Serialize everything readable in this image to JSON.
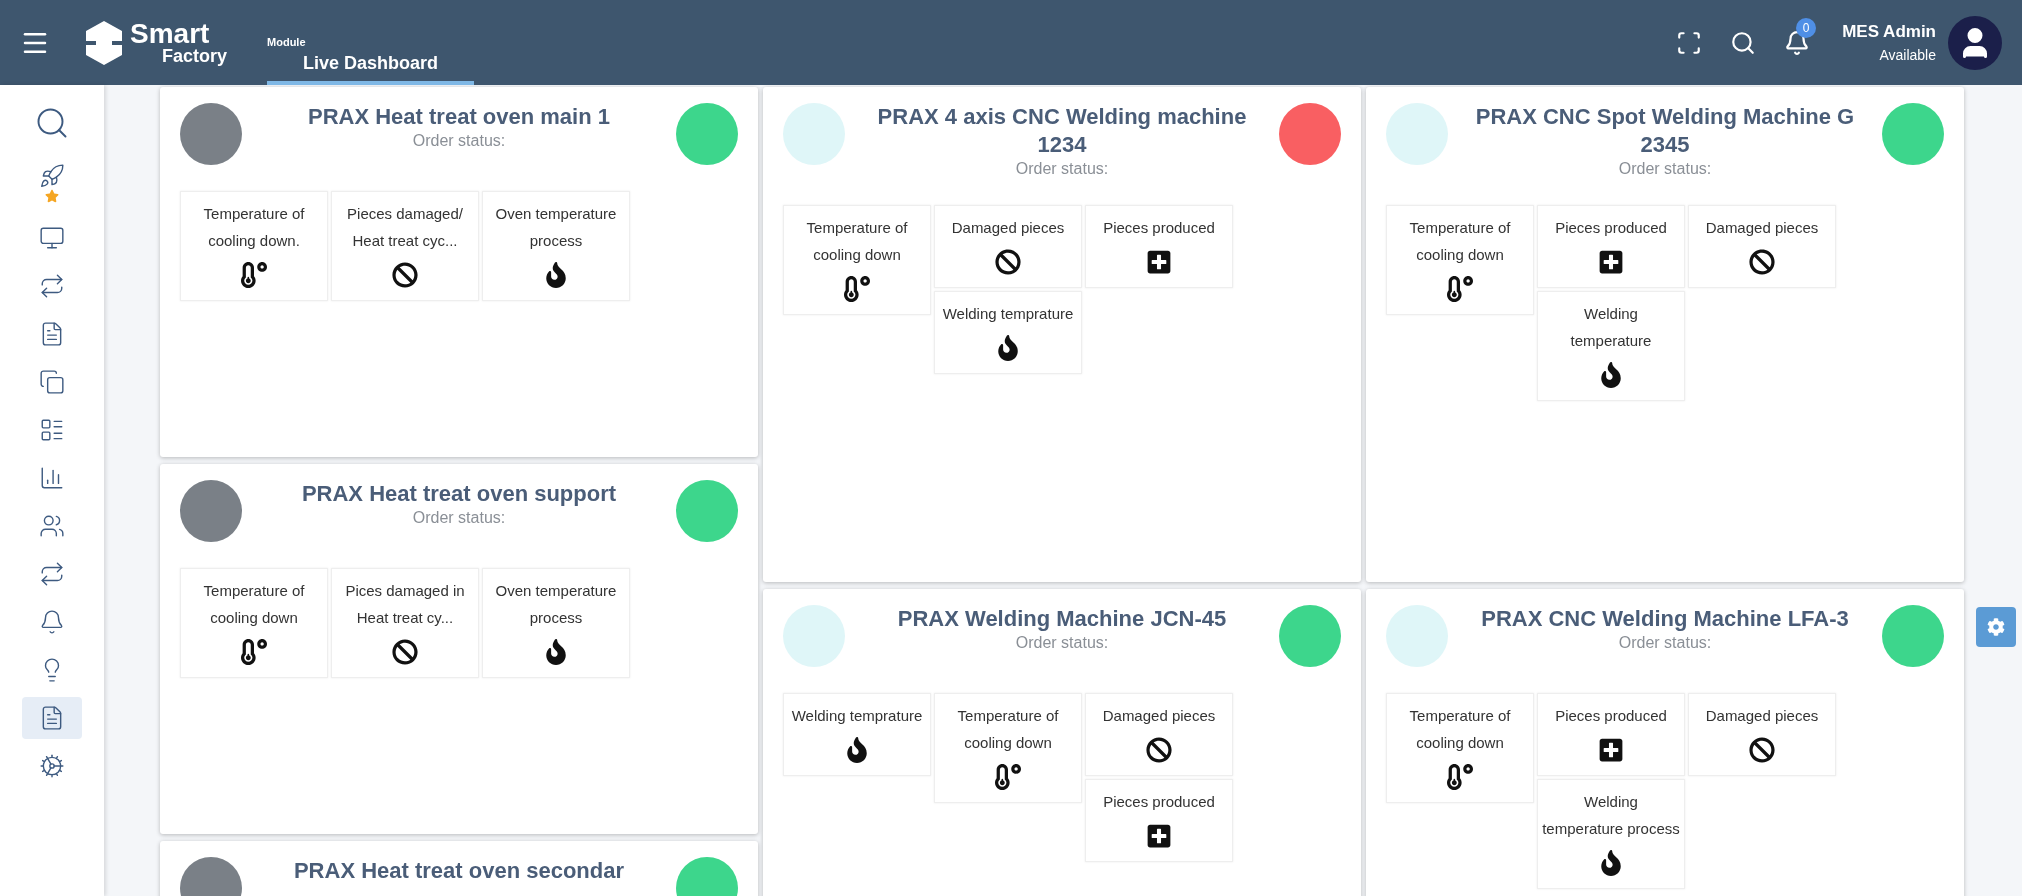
{
  "header": {
    "logo": {
      "line1": "Smart",
      "line2": "Factory"
    },
    "module_label": "Module",
    "tab": {
      "label": "Live Dashboard",
      "selected": true
    },
    "notifications": "0",
    "user": {
      "name": "MES Admin",
      "status": "Available"
    }
  },
  "sidebar": [
    {
      "kind": "search",
      "selected": false
    },
    {
      "kind": "rocket",
      "selected": false
    },
    {
      "kind": "monitor",
      "selected": false
    },
    {
      "kind": "repeat",
      "selected": false
    },
    {
      "kind": "document",
      "selected": false
    },
    {
      "kind": "copy",
      "selected": false
    },
    {
      "kind": "list",
      "selected": false
    },
    {
      "kind": "chart",
      "selected": false
    },
    {
      "kind": "users",
      "selected": false
    },
    {
      "kind": "repeat",
      "selected": false
    },
    {
      "kind": "bell",
      "selected": false
    },
    {
      "kind": "bulb",
      "selected": false
    },
    {
      "kind": "document",
      "selected": true
    },
    {
      "kind": "cogs",
      "selected": false
    }
  ],
  "columns": [
    [
      {
        "title_lines": [
          "PRAX Heat treat oven main 1"
        ],
        "subtitle": "Order status:",
        "color": "#3dd68c",
        "tiles": [
          [
            {
              "label": "Temperature of cooling down.",
              "kind": "thermometer"
            }
          ],
          [
            {
              "label": "Pieces damaged/ Heat treat cyc...",
              "kind": "ban"
            }
          ],
          [
            {
              "label": "Oven temperature process",
              "kind": "fire"
            }
          ]
        ]
      },
      {
        "title_lines": [
          "PRAX Heat treat oven support"
        ],
        "subtitle": "Order status:",
        "color": "#3dd68c",
        "tiles": [
          [
            {
              "label": "Temperature of cooling down",
              "kind": "thermometer"
            }
          ],
          [
            {
              "label": "Pices damaged in Heat treat cy...",
              "kind": "ban"
            }
          ],
          [
            {
              "label": "Oven temperature process",
              "kind": "fire"
            }
          ]
        ]
      },
      {
        "title_lines": [
          "PRAX Heat treat oven secondar"
        ],
        "color": "#3dd68c"
      }
    ],
    [
      {
        "title_lines": [
          "PRAX 4 axis CNC Welding machine",
          "1234"
        ],
        "subtitle": "Order status:",
        "color": "#f95f62",
        "tiles": [
          [
            {
              "label": "Temperature of cooling down",
              "kind": "thermometer"
            }
          ],
          [
            {
              "label": "Damaged pieces",
              "kind": "ban"
            },
            {
              "label": "Welding temprature",
              "kind": "fire"
            }
          ],
          [
            {
              "label": "Pieces produced",
              "kind": "plus"
            }
          ]
        ]
      },
      {
        "title_lines": [
          "PRAX Welding Machine JCN-45"
        ],
        "subtitle": "Order status:",
        "color": "#3dd68c",
        "tiles": [
          [
            {
              "label": "Welding temprature",
              "kind": "fire"
            }
          ],
          [
            {
              "label": "Temperature of cooling down",
              "kind": "thermometer"
            }
          ],
          [
            {
              "label": "Damaged pieces",
              "kind": "ban"
            },
            {
              "label": "Pieces produced",
              "kind": "plus"
            }
          ]
        ]
      }
    ],
    [
      {
        "title_lines": [
          "PRAX CNC Spot Welding Machine G",
          "2345"
        ],
        "subtitle": "Order status:",
        "color": "#3dd68c",
        "tiles": [
          [
            {
              "label": "Temperature of cooling down",
              "kind": "thermometer"
            }
          ],
          [
            {
              "label": "Pieces produced",
              "kind": "plus"
            },
            {
              "label": "Welding temperature",
              "kind": "fire"
            }
          ],
          [
            {
              "label": "Damaged pieces",
              "kind": "ban"
            }
          ]
        ]
      },
      {
        "title_lines": [
          "PRAX CNC Welding Machine LFA-3"
        ],
        "subtitle": "Order status:",
        "color": "#3dd68c",
        "tiles": [
          [
            {
              "label": "Temperature of cooling down",
              "kind": "thermometer"
            }
          ],
          [
            {
              "label": "Pieces produced",
              "kind": "plus"
            },
            {
              "label": "Welding temperature process",
              "kind": "fire"
            }
          ],
          [
            {
              "label": "Damaged pieces",
              "kind": "ban"
            }
          ]
        ]
      }
    ]
  ]
}
